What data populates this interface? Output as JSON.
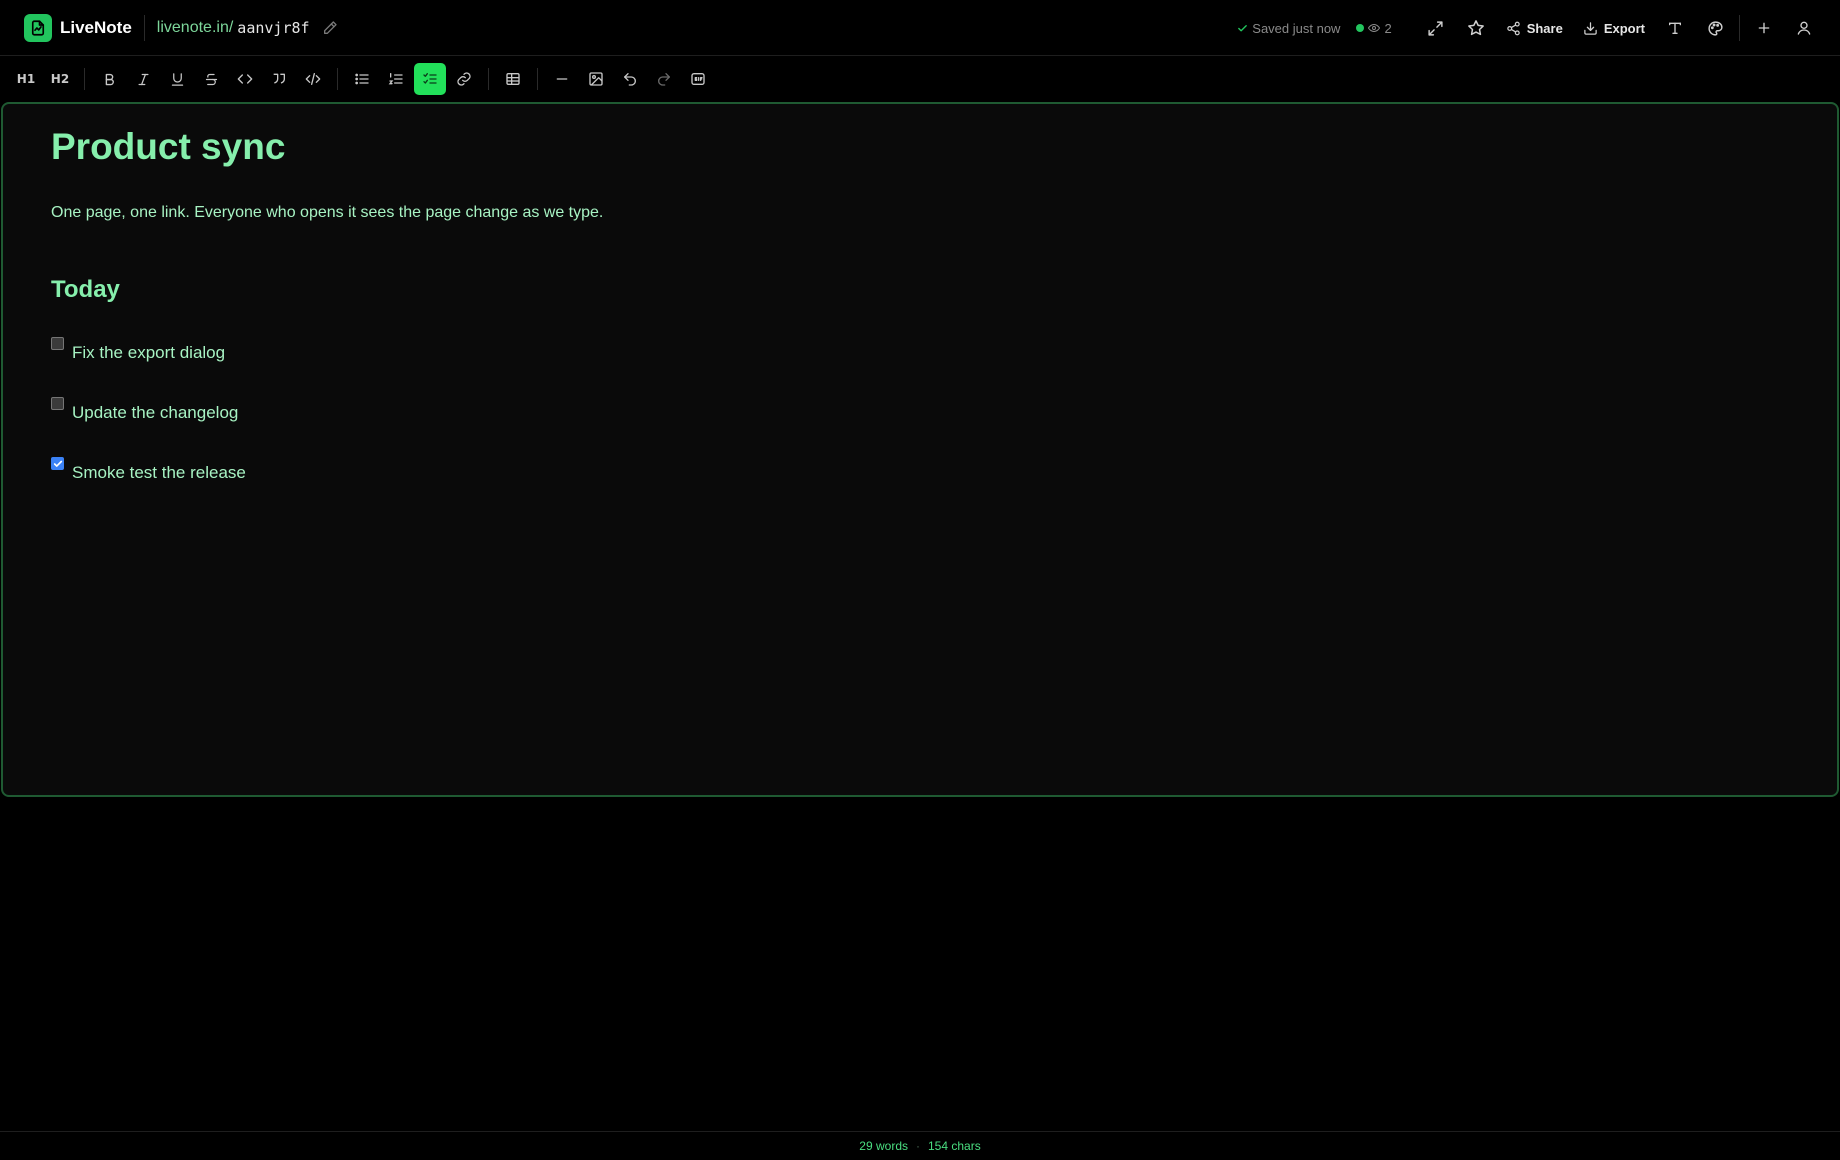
{
  "app": {
    "name": "LiveNote",
    "brand_color": "#22c55e",
    "accent_color": "#86efac"
  },
  "url": {
    "host": "livenote.in/",
    "slug": "aanvjr8f"
  },
  "status": {
    "saved_text": "Saved just now",
    "viewer_count": "2"
  },
  "top_actions": {
    "share_label": "Share",
    "export_label": "Export"
  },
  "format_toolbar": {
    "h1": "H1",
    "h2": "H2",
    "active_tool": "task-list"
  },
  "document": {
    "title": "Product sync",
    "paragraph": "One page, one link. Everyone who opens it sees the page change as we type.",
    "section_heading": "Today",
    "tasks": [
      {
        "label": "Fix the export dialog",
        "checked": false
      },
      {
        "label": "Update the changelog",
        "checked": false
      },
      {
        "label": "Smoke test the release",
        "checked": true
      }
    ]
  },
  "footer": {
    "words": "29 words",
    "separator": "·",
    "chars": "154 chars"
  }
}
